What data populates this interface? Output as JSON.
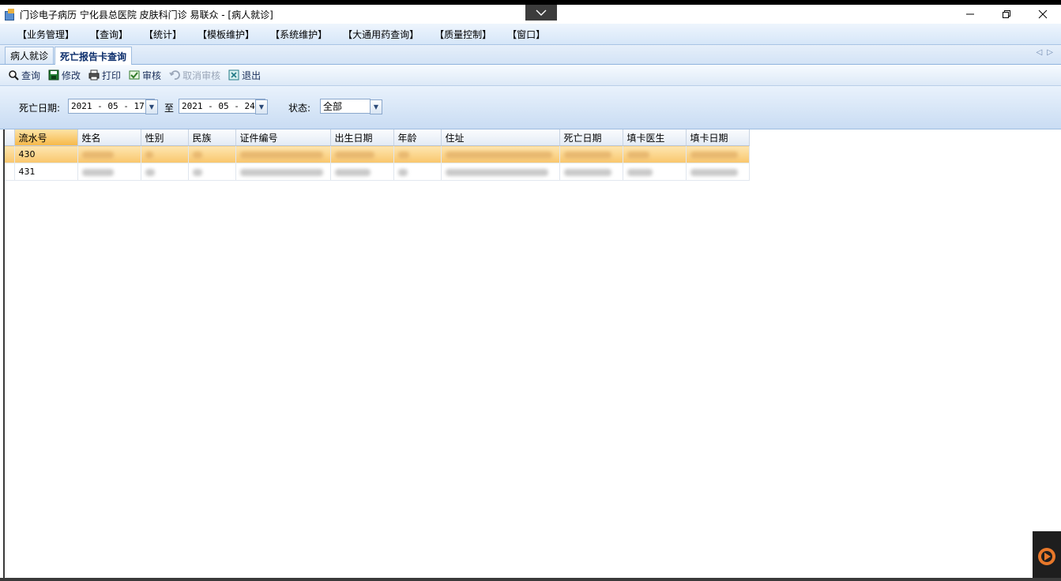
{
  "window": {
    "title": "门诊电子病历  宁化县总医院  皮肤科门诊  易联众 - [病人就诊]"
  },
  "menu": [
    "【业务管理】",
    "【查询】",
    "【统计】",
    "【模板维护】",
    "【系统维护】",
    "【大通用药查询】",
    "【质量控制】",
    "【窗口】"
  ],
  "tabs": {
    "tab1": "病人就诊",
    "tab2": "死亡报告卡查询"
  },
  "toolbar": {
    "query": "查询",
    "modify": "修改",
    "print": "打印",
    "audit": "审核",
    "cancel_audit": "取消审核",
    "exit": "退出"
  },
  "filter": {
    "death_date_label": "死亡日期:",
    "from_date": "2021 - 05 - 17",
    "to_label": "至",
    "to_date": "2021 - 05 - 24",
    "status_label": "状态:",
    "status_value": "全部"
  },
  "table": {
    "columns": [
      "流水号",
      "姓名",
      "性别",
      "民族",
      "证件编号",
      "出生日期",
      "年龄",
      "住址",
      "死亡日期",
      "填卡医生",
      "填卡日期"
    ],
    "rows": [
      {
        "serial": "430",
        "selected": true
      },
      {
        "serial": "431",
        "selected": false
      }
    ]
  },
  "colors": {
    "selection": "#f9c66c",
    "toolbar_bg": "#dde9f7",
    "tab_text": "#0b2d6b"
  }
}
